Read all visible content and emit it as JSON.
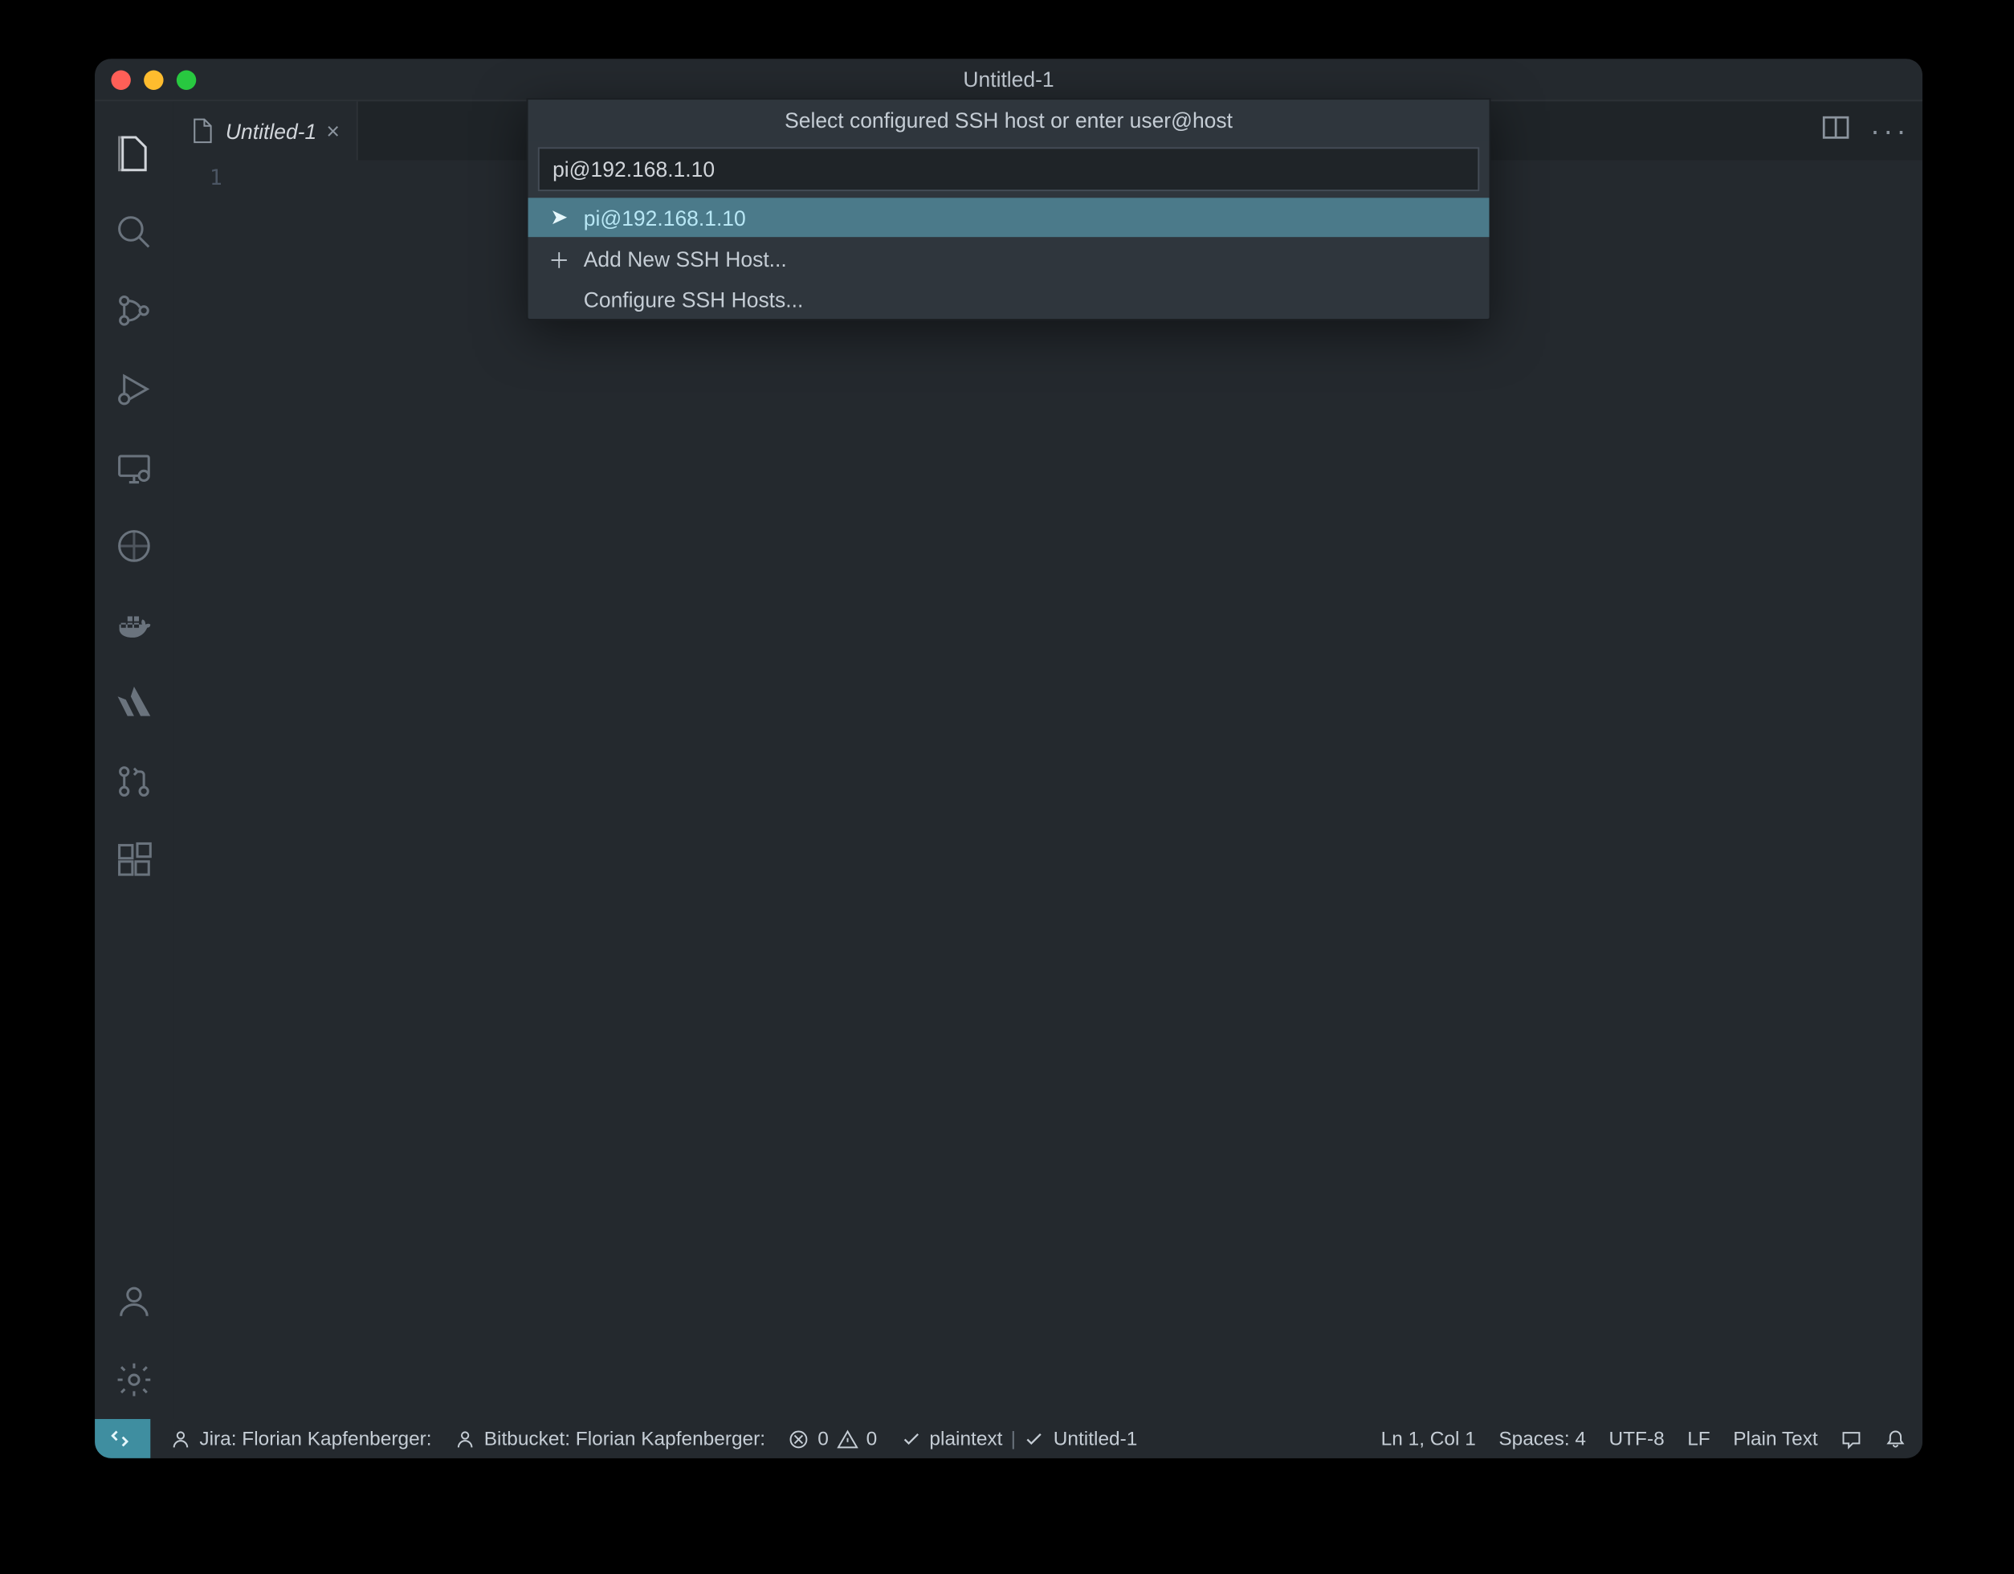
{
  "window": {
    "title": "Untitled-1"
  },
  "tabs": [
    {
      "label": "Untitled-1"
    }
  ],
  "editor": {
    "line_number": "1"
  },
  "palette": {
    "title": "Select configured SSH host or enter user@host",
    "input_value": "pi@192.168.1.10",
    "items": [
      {
        "label": "pi@192.168.1.10",
        "icon": "arrow",
        "highlight": true
      },
      {
        "label": "Add New SSH Host...",
        "icon": "plus",
        "highlight": false
      },
      {
        "label": "Configure SSH Hosts...",
        "icon": "none",
        "highlight": false
      }
    ]
  },
  "statusbar": {
    "jira_label": "Jira: Florian Kapfenberger:",
    "bitbucket_label": "Bitbucket: Florian Kapfenberger:",
    "errors": "0",
    "warnings": "0",
    "lang_check": "plaintext",
    "file_check": "Untitled-1",
    "cursor": "Ln 1, Col 1",
    "spaces": "Spaces: 4",
    "encoding": "UTF-8",
    "eol": "LF",
    "mode": "Plain Text"
  }
}
